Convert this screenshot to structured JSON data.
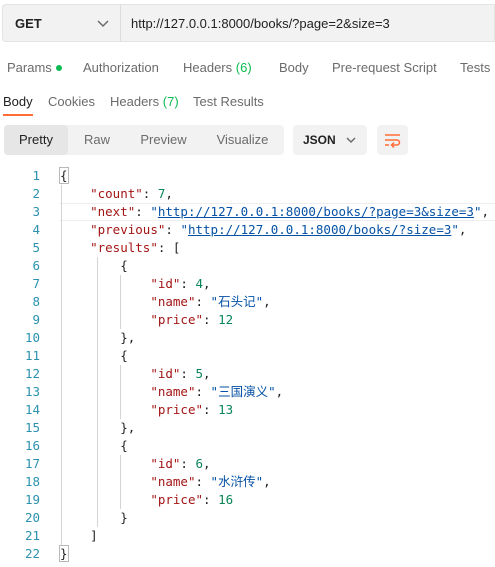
{
  "request": {
    "method": "GET",
    "url": "http://127.0.0.1:8000/books/?page=2&size=3"
  },
  "request_tabs": {
    "params": "Params",
    "authorization": "Authorization",
    "headers": "Headers",
    "headers_count": "(6)",
    "body": "Body",
    "prerequest": "Pre-request Script",
    "tests": "Tests"
  },
  "response_tabs": {
    "body": "Body",
    "cookies": "Cookies",
    "headers": "Headers",
    "headers_count": "(7)",
    "test_results": "Test Results"
  },
  "view_modes": {
    "pretty": "Pretty",
    "raw": "Raw",
    "preview": "Preview",
    "visualize": "Visualize",
    "format": "JSON"
  },
  "response_json": {
    "count": 7,
    "next": "http://127.0.0.1:8000/books/?page=3&size=3",
    "previous": "http://127.0.0.1:8000/books/?size=3",
    "results": [
      {
        "id": 4,
        "name": "石头记",
        "price": 12
      },
      {
        "id": 5,
        "name": "三国演义",
        "price": 13
      },
      {
        "id": 6,
        "name": "水浒传",
        "price": 16
      }
    ]
  },
  "colors": {
    "accent": "#ff6c37",
    "status_dot": "#0cbb52",
    "json_key": "#a31515",
    "json_string": "#0451a5",
    "json_number": "#098658",
    "line_number": "#2b91af"
  }
}
